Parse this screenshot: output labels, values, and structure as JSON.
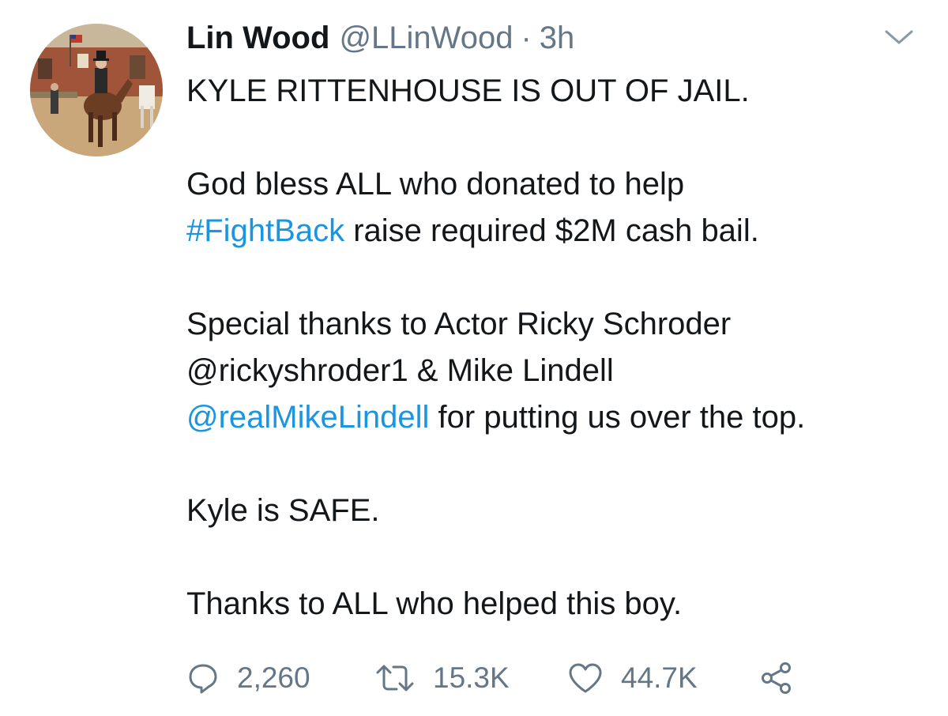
{
  "tweet": {
    "author": {
      "display_name": "Lin Wood",
      "handle": "@LLinWood",
      "separator": "·",
      "time": "3h",
      "avatar_icon": "painting-horse-rider-avatar"
    },
    "body": {
      "p1": "KYLE RITTENHOUSE IS OUT OF JAIL.",
      "p2_line1": "God bless ALL who donated to help",
      "p2_hashtag": "#FightBack",
      "p2_line2_rest": " raise required $2M cash bail.",
      "p3_line1": "Special thanks to Actor Ricky Schroder",
      "p3_line2": "@rickyshroder1 & Mike Lindell",
      "p3_mention": "@realMikeLindell",
      "p3_line3_rest": " for putting us over the top.",
      "p4": "Kyle is SAFE.",
      "p5": "Thanks to ALL who helped this boy."
    },
    "actions": {
      "replies": "2,260",
      "retweets": "15.3K",
      "likes": "44.7K",
      "reply_icon": "speech-bubble-icon",
      "retweet_icon": "retweet-icon",
      "like_icon": "heart-icon",
      "share_icon": "share-icon"
    },
    "menu_icon": "chevron-down-icon"
  },
  "colors": {
    "text": "#14171a",
    "secondary": "#657786",
    "link": "#1b95e0",
    "background": "#ffffff"
  }
}
